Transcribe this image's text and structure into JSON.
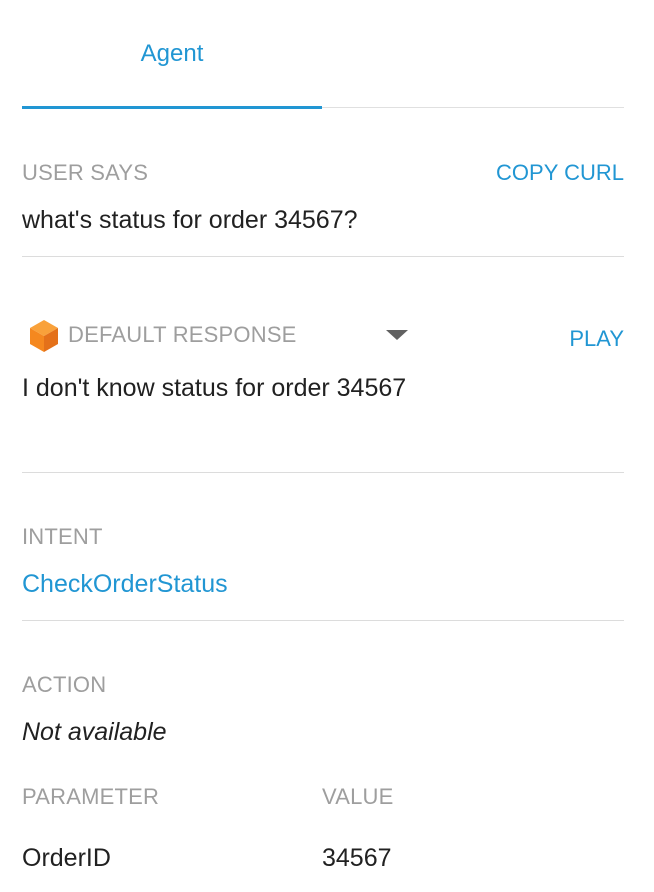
{
  "tabs": [
    {
      "label": "Agent",
      "active": true
    }
  ],
  "user_says": {
    "label": "USER SAYS",
    "copy_curl": "COPY CURL",
    "value": "what's status for order 34567?"
  },
  "response": {
    "icon": "cube-icon",
    "label": "DEFAULT RESPONSE",
    "play": "PLAY",
    "value": "I don't know status for order 34567"
  },
  "intent": {
    "label": "INTENT",
    "value": "CheckOrderStatus"
  },
  "action": {
    "label": "ACTION",
    "value": "Not available"
  },
  "parameters": {
    "header_parameter": "PARAMETER",
    "header_value": "VALUE",
    "rows": [
      {
        "name": "OrderID",
        "value": "34567"
      }
    ]
  },
  "colors": {
    "accent": "#2196d3",
    "label_gray": "#9e9e9e",
    "cube_orange": "#f5881f"
  }
}
